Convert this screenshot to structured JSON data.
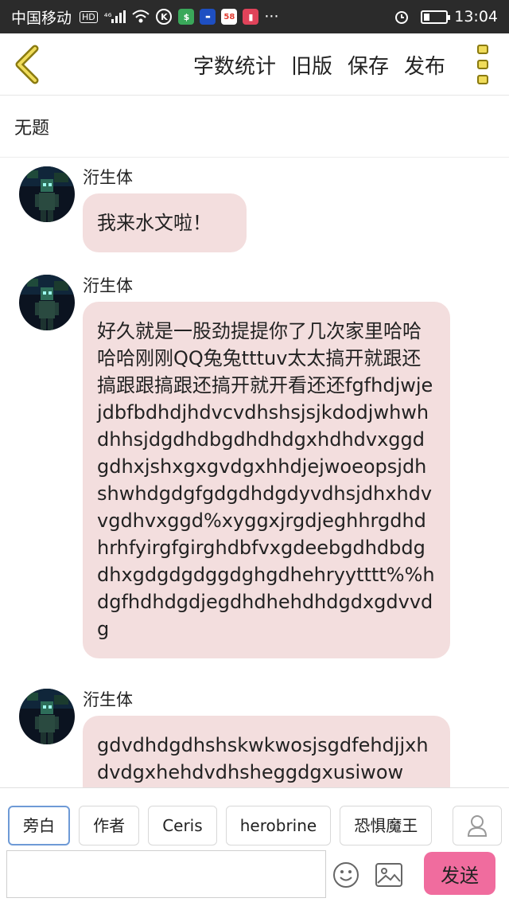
{
  "status_bar": {
    "carrier": "中国移动",
    "hd": "HD",
    "network": "⁴⁶",
    "time": "13:04",
    "dots": "···"
  },
  "toolbar": {
    "back_icon": "chevron-left-icon",
    "word_count": "字数统计",
    "old_version": "旧版",
    "save": "保存",
    "publish": "发布"
  },
  "document": {
    "title": "无题"
  },
  "messages": [
    {
      "author": "洐生体",
      "text": "我来水文啦！"
    },
    {
      "author": "洐生体",
      "text": "好久就是一股劲提提你了几次家里哈哈哈哈刚刚QQ兔兔tttuv太太搞开就跟还搞跟跟搞跟还搞开就开看还还fgfhdjwjejdbfbdhdjhdvcvdhshsjsjkdodjwhwhdhhsjdgdhdbgdhdhdgxhdhdvxggdgdhxjshxgxgvdgxhhdjejwoeopsjdhshwhdgdgfgdgdhdgdyvdhsjdhxhdvvgdhvxggd%xyggxjrgdjeghhrgdhdhrhfyirgfgirghdbfvxgdeebgdhdbdgdhxgdgdgdggdghgdhehryytttt%%hdgfhdhdgdjegdhdhehdhdgdxgdvvdg"
    },
    {
      "author": "洐生体",
      "text": "gdvdhdgdhshskwkwosjsgdfehdjjxhdvdgxhehdvdhsheggdgxusiwow"
    }
  ],
  "roles": [
    "旁白",
    "作者",
    "Ceris",
    "herobrine",
    "恐惧魔王"
  ],
  "composer": {
    "placeholder": "",
    "send_label": "发送"
  },
  "colors": {
    "bubble": "#f3dede",
    "send_button": "#f06c9e",
    "menu_dots": "#f0dc5a",
    "back_chevron": "#f0dc5a"
  }
}
